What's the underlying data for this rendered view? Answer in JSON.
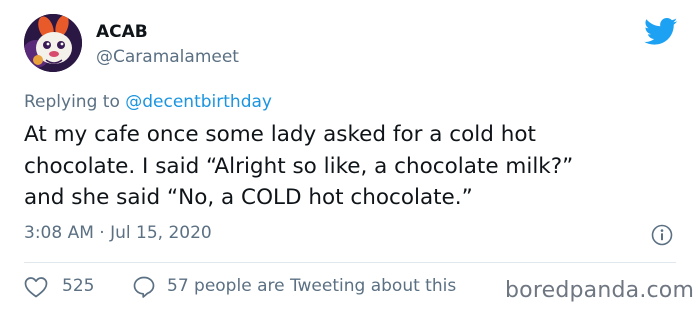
{
  "tweet": {
    "display_name": "ACAB",
    "handle": "@Caramalameet",
    "replying_prefix": "Replying to ",
    "replying_to": "@decentbirthday",
    "text_lines": [
      "At my cafe once some lady asked for a cold hot",
      "chocolate. I said “Alright so like, a chocolate milk?”",
      "and she said “No, a COLD hot chocolate.”"
    ],
    "timestamp": "3:08 AM · Jul 15, 2020",
    "likes": "525",
    "conversation": "57 people are Tweeting about this"
  },
  "watermark": "boredpanda.com",
  "icons": {
    "brand": "twitter-bird-icon",
    "info": "info-icon",
    "like": "heart-icon",
    "reply": "speech-bubble-icon"
  },
  "colors": {
    "text": "#0f1419",
    "secondary": "#5b7083",
    "link": "#1b95e0",
    "twitter_blue": "#1da1f2"
  }
}
